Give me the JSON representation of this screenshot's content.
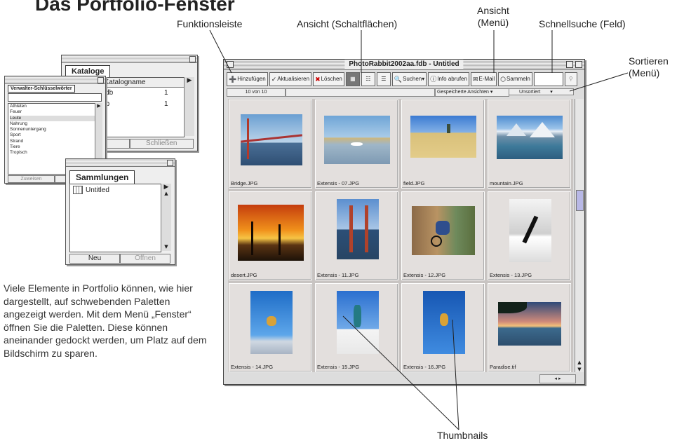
{
  "heading": "Das Portfolio-Fenster",
  "callouts": {
    "funktionsleiste": "Funktionsleiste",
    "ansicht_buttons": "Ansicht (Schaltflächen)",
    "ansicht_menu_1": "Ansicht",
    "ansicht_menu_2": "(Menü)",
    "schnellsuche": "Schnellsuche (Feld)",
    "sortieren_1": "Sortieren",
    "sortieren_2": "(Menü)",
    "thumbnails": "Thumbnails"
  },
  "description": "Viele Elemente in Portfolio können, wie hier dargestellt, auf schwebenden Paletten angezeigt werden. Mit dem Menü „Fenster“ öffnen Sie die Paletten. Diese können aneinander gedockt werden, um Platz auf dem Bildschirm zu sparen.",
  "kataloge": {
    "tab": "Kataloge",
    "column": "Katalogname",
    "rows": [
      {
        "name": "tel.fdb",
        "count": "1"
      },
      {
        "name": "o.fdb",
        "count": "1"
      }
    ],
    "close": "Schließen"
  },
  "keywords": {
    "title": "Verwalter-Schlüsselwörter",
    "items": [
      "Athleten",
      "Feuer",
      "Leute",
      "Nahrung",
      "Sonnenuntergang",
      "Sport",
      "Strand",
      "Tiere",
      "Tropisch"
    ],
    "assign": "Zuweisen"
  },
  "sammlungen": {
    "tab": "Sammlungen",
    "item": "Untitled",
    "new": "Neu",
    "open": "Öffnen"
  },
  "window": {
    "title": "PhotoRabbit2002aa.fdb - Untitled",
    "toolbar": {
      "add": "Hinzufügen",
      "update": "Aktualisieren",
      "delete": "Löschen",
      "search": "Suchen",
      "info": "Info abrufen",
      "email": "E-Mail",
      "collect": "Sammeln"
    },
    "count": "10 von 10",
    "saved_views": "Gespeicherte Ansichten",
    "sort": "Unsortiert",
    "thumbs": [
      {
        "name": "Bridge.JPG",
        "img": "bridge"
      },
      {
        "name": "Extensis - 07.JPG",
        "img": "lake"
      },
      {
        "name": "field.JPG",
        "img": "field"
      },
      {
        "name": "mountain.JPG",
        "img": "mountain"
      },
      {
        "name": "desert.JPG",
        "img": "desert"
      },
      {
        "name": "Extensis - 11.JPG",
        "img": "goldengate"
      },
      {
        "name": "Extensis - 12.JPG",
        "img": "bike"
      },
      {
        "name": "Extensis - 13.JPG",
        "img": "ski"
      },
      {
        "name": "Extensis - 14.JPG",
        "img": "jump"
      },
      {
        "name": "Extensis - 15.JPG",
        "img": "skier"
      },
      {
        "name": "Extensis - 16.JPG",
        "img": "aerial"
      },
      {
        "name": "Paradise.tif",
        "img": "sunset"
      }
    ]
  }
}
